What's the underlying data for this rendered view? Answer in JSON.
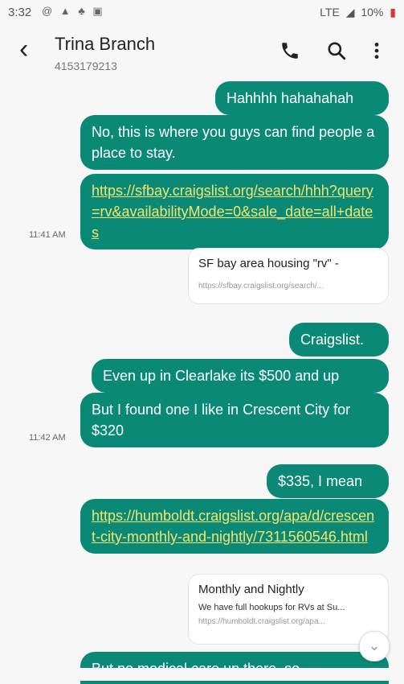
{
  "status_bar": {
    "time": "3:32",
    "notif_icons": "@ ▲ ♣ ▣",
    "network": "LTE",
    "battery": "10%"
  },
  "header": {
    "contact_name": "Trina Branch",
    "contact_number": "4153179213"
  },
  "messages": [
    {
      "text": "Hahhhh hahahahah"
    },
    {
      "text": "No, this is where you guys can find people a place to stay."
    },
    {
      "text": "https://sfbay.craigslist.org/search/hhh?query=rv&availabilityMode=0&sale_date=all+dates"
    },
    {
      "text": "Craigslist."
    },
    {
      "text": "Even up in Clearlake its $500 and up"
    },
    {
      "text": "But I found one I like in Crescent City for $320"
    },
    {
      "text": "$335, I mean"
    },
    {
      "text": "https://humboldt.craigslist.org/apa/d/crescent-city-monthly-and-nightly/7311560546.html"
    },
    {
      "text": "But no medical care up there, so"
    }
  ],
  "timestamps": [
    "11:41 AM",
    "11:42 AM"
  ],
  "previews": [
    {
      "title": "SF bay area housing \"rv\" -",
      "desc": "",
      "url": "https://sfbay.craigslist.org/search/..."
    },
    {
      "title": "Monthly and Nightly",
      "desc": "We have full hookups for RVs at Su...",
      "url": "https://humboldt.craigslist.org/apa..."
    }
  ]
}
